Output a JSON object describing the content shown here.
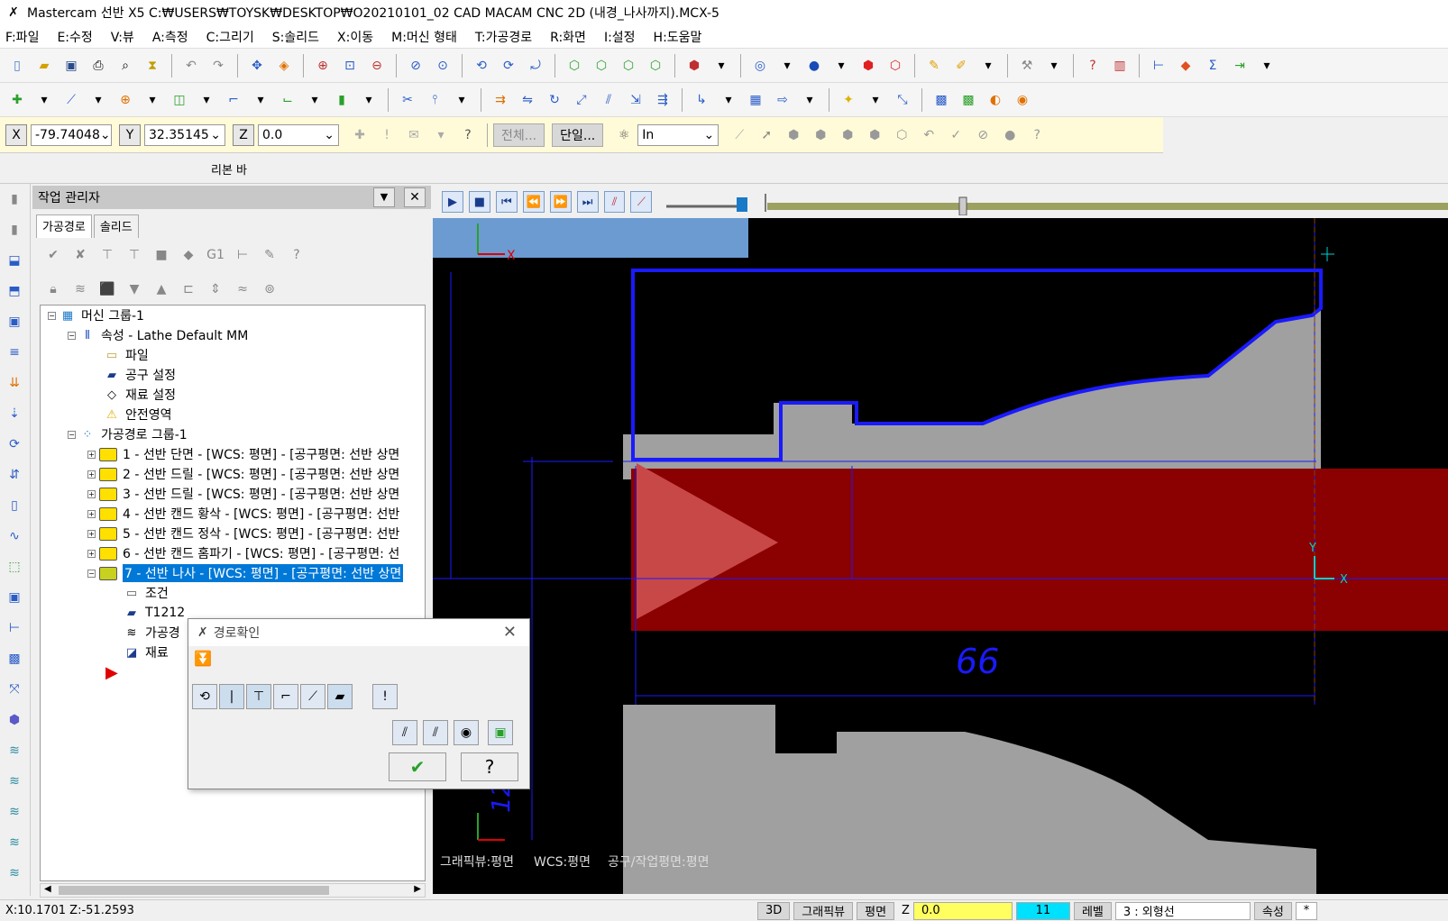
{
  "window": {
    "title": "Mastercam 선반 X5  C:₩USERS₩TOYSK₩DESKTOP₩O20210101_02 CAD MACAM CNC 2D (내경_나사까지).MCX-5"
  },
  "menu": [
    "F:파일",
    "E:수정",
    "V:뷰",
    "A:측정",
    "C:그리기",
    "S:솔리드",
    "X:이동",
    "M:머신 형태",
    "T:가공경로",
    "R:화면",
    "I:설정",
    "H:도움말"
  ],
  "coords": {
    "x_label": "X",
    "x_value": "-79.74048",
    "y_label": "Y",
    "y_value": "32.35145",
    "z_label": "Z",
    "z_value": "0.0",
    "all_btn": "전체...",
    "single_btn": "단일...",
    "unit": "In"
  },
  "ribbon_label": "리본 바",
  "opmgr": {
    "title": "작업 관리자",
    "tabs": [
      "가공경로",
      "솔리드"
    ],
    "tree": [
      {
        "label": "머신 그룹-1"
      },
      {
        "label": "속성 - Lathe Default MM"
      },
      {
        "label": "파일"
      },
      {
        "label": "공구 설정"
      },
      {
        "label": "재료 설정"
      },
      {
        "label": "안전영역"
      },
      {
        "label": "가공경로 그룹-1"
      },
      {
        "label": "1 - 선반 단면 - [WCS: 평면] - [공구평면: 선반 상면"
      },
      {
        "label": "2 - 선반 드릴 - [WCS: 평면] - [공구평면: 선반 상면"
      },
      {
        "label": "3 - 선반 드릴 - [WCS: 평면] - [공구평면: 선반 상면"
      },
      {
        "label": "4 - 선반 캔드 황삭 - [WCS: 평면] - [공구평면: 선반"
      },
      {
        "label": "5 - 선반 캔드 정삭 - [WCS: 평면] - [공구평면: 선반"
      },
      {
        "label": "6 - 선반 캔드 홈파기 - [WCS: 평면] - [공구평면: 선"
      },
      {
        "label": "7 - 선반 나사 - [WCS: 평면] - [공구평면: 선반 상면"
      },
      {
        "label": "조건"
      },
      {
        "label": "T1212"
      },
      {
        "label": "가공경"
      },
      {
        "label": "재료 "
      }
    ]
  },
  "dialog": {
    "title": "경로확인"
  },
  "viewport": {
    "dim_label": "66",
    "dim_label2": "120",
    "axis_x": "X",
    "axis_y": "Y",
    "status_graphic": "그래픽뷰:평면",
    "status_wcs": "WCS:평면",
    "status_tool": "공구/작업평면:평면"
  },
  "statusbar": {
    "coords": "X:10.1701   Z:-51.2593",
    "btn_3d": "3D",
    "btn_graphicview": "그래픽뷰",
    "btn_plane": "평면",
    "z_label": "Z",
    "z_value": "0.0",
    "level_num": "11",
    "level_label": "레벨",
    "level_value": "3 : 외형선",
    "attr_btn": "속성",
    "star": "*"
  },
  "colors": {
    "accent": "#0078d7",
    "toolpath_red": "#8b0000",
    "stock_gray": "#a0a0a0",
    "highlight_blue": "#0000ff"
  }
}
